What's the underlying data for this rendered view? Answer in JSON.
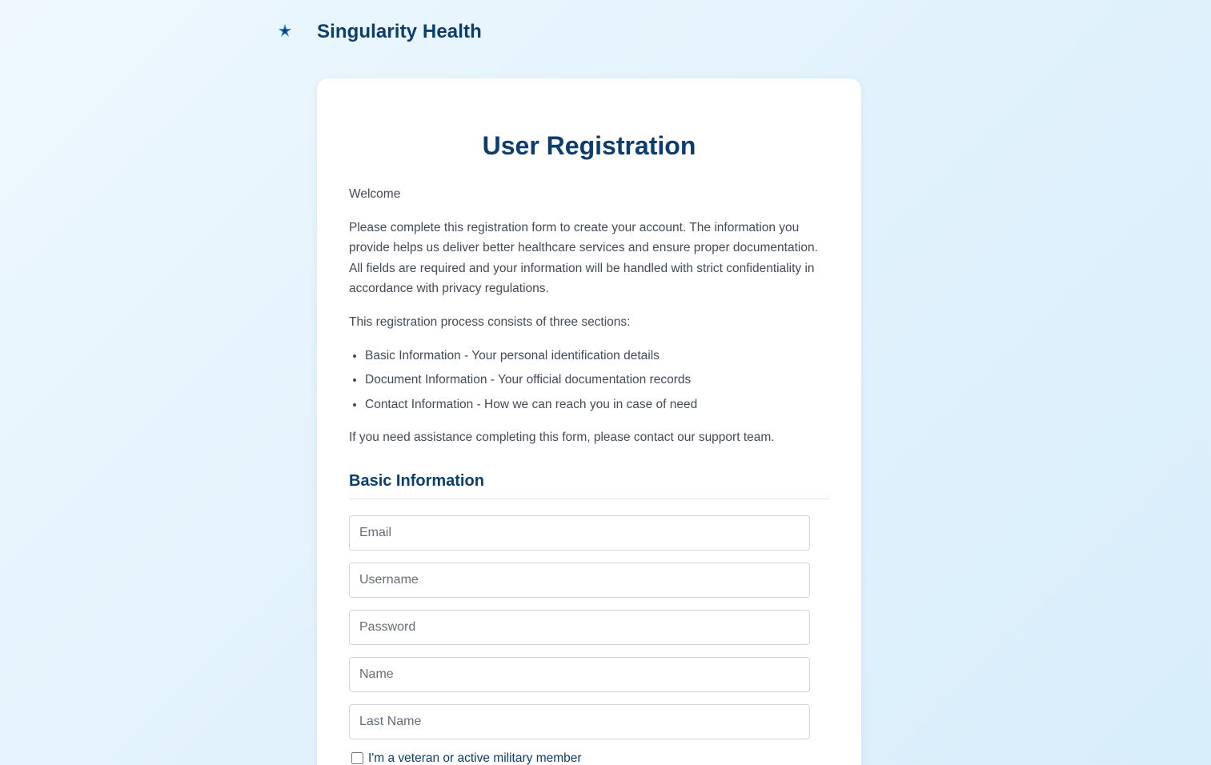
{
  "brand": {
    "name": "Singularity Health",
    "logo_icon": "star-person-logo-icon"
  },
  "form": {
    "title": "User Registration",
    "welcome": "Welcome",
    "description": "Please complete this registration form to create your account. The information you provide helps us deliver better healthcare services and ensure proper documentation. All fields are required and your information will be handled with strict confidentiality in accordance with privacy regulations.",
    "sections_intro": "This registration process consists of three sections:",
    "sections": [
      "Basic Information - Your personal identification details",
      "Document Information - Your official documentation records",
      "Contact Information - How we can reach you in case of need"
    ],
    "assistance": "If you need assistance completing this form, please contact our support team."
  },
  "basic_info": {
    "title": "Basic Information",
    "email_placeholder": "Email",
    "username_placeholder": "Username",
    "password_placeholder": "Password",
    "name_placeholder": "Name",
    "last_name_placeholder": "Last Name",
    "veteran_label": "I'm a veteran or active military member"
  },
  "colors": {
    "brand_navy": "#0b3d6e",
    "background": "#e2f2fc",
    "logo_blue": "#1e88e5"
  }
}
